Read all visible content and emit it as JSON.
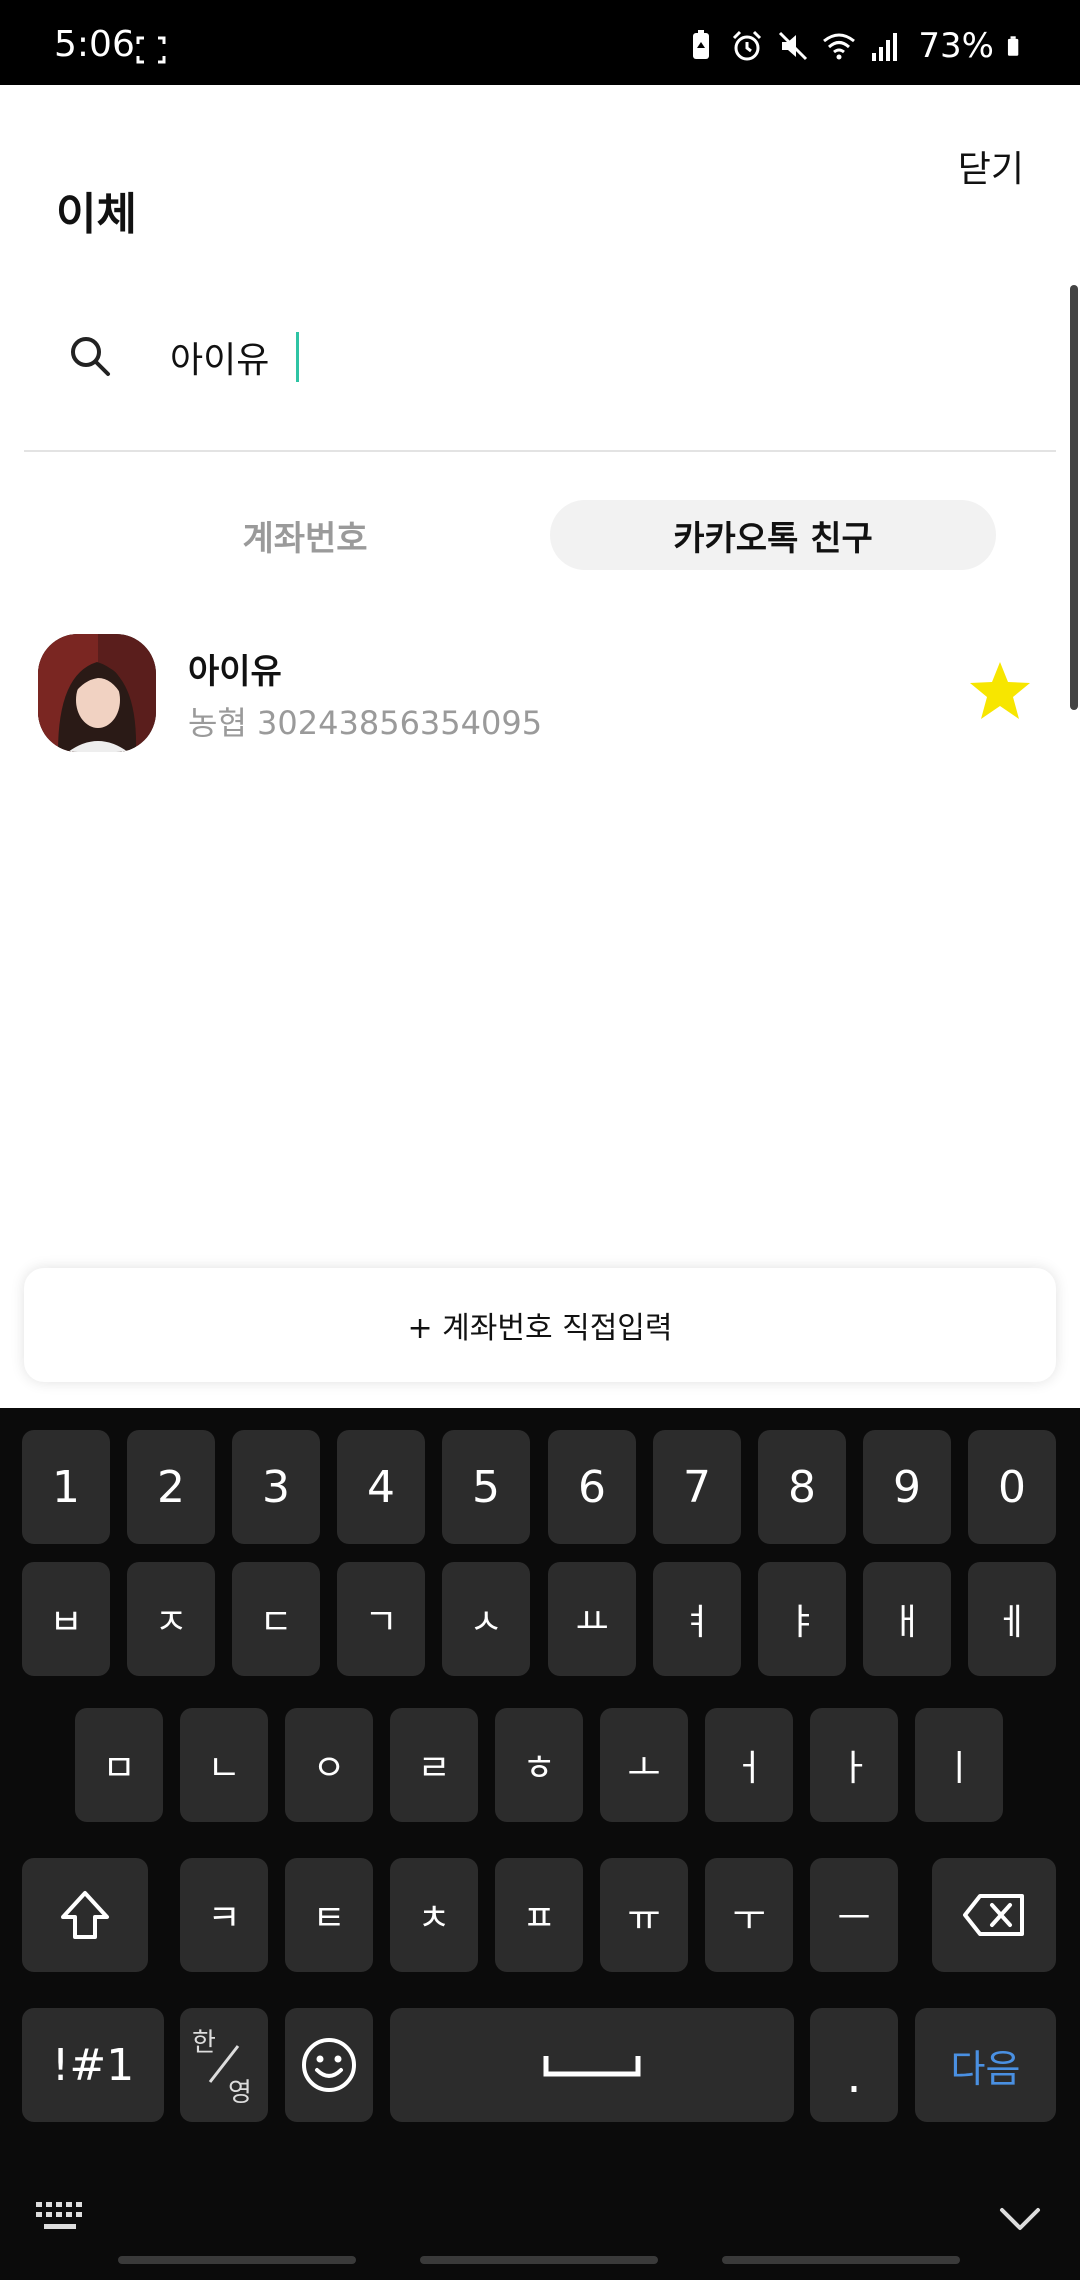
{
  "status_bar": {
    "time": "5:06",
    "battery": "73%"
  },
  "header": {
    "title": "이체",
    "close_label": "닫기"
  },
  "search": {
    "value": "아이유",
    "placeholder": ""
  },
  "tabs": [
    {
      "label": "계좌번호",
      "selected": false
    },
    {
      "label": "카카오톡 친구",
      "selected": true
    }
  ],
  "results": [
    {
      "name": "아이유",
      "account": "농협 30243856354095",
      "favorite": true
    }
  ],
  "direct_input_label": "+ 계좌번호 직접입력",
  "keyboard": {
    "row1": [
      "1",
      "2",
      "3",
      "4",
      "5",
      "6",
      "7",
      "8",
      "9",
      "0"
    ],
    "row2": [
      "ㅂ",
      "ㅈ",
      "ㄷ",
      "ㄱ",
      "ㅅ",
      "ㅛ",
      "ㅕ",
      "ㅑ",
      "ㅐ",
      "ㅔ"
    ],
    "row3": [
      "ㅁ",
      "ㄴ",
      "ㅇ",
      "ㄹ",
      "ㅎ",
      "ㅗ",
      "ㅓ",
      "ㅏ",
      "ㅣ"
    ],
    "row4": [
      "ㅋ",
      "ㅌ",
      "ㅊ",
      "ㅍ",
      "ㅠ",
      "ㅜ",
      "ㅡ"
    ],
    "symbols_label": "!#1",
    "lang_top": "한",
    "lang_bottom": "영",
    "period_label": ".",
    "next_label": "다음"
  },
  "colors": {
    "accent_caret": "#2ec4a4",
    "favorite_star": "#f7e600",
    "keyboard_next": "#4a90e2"
  }
}
